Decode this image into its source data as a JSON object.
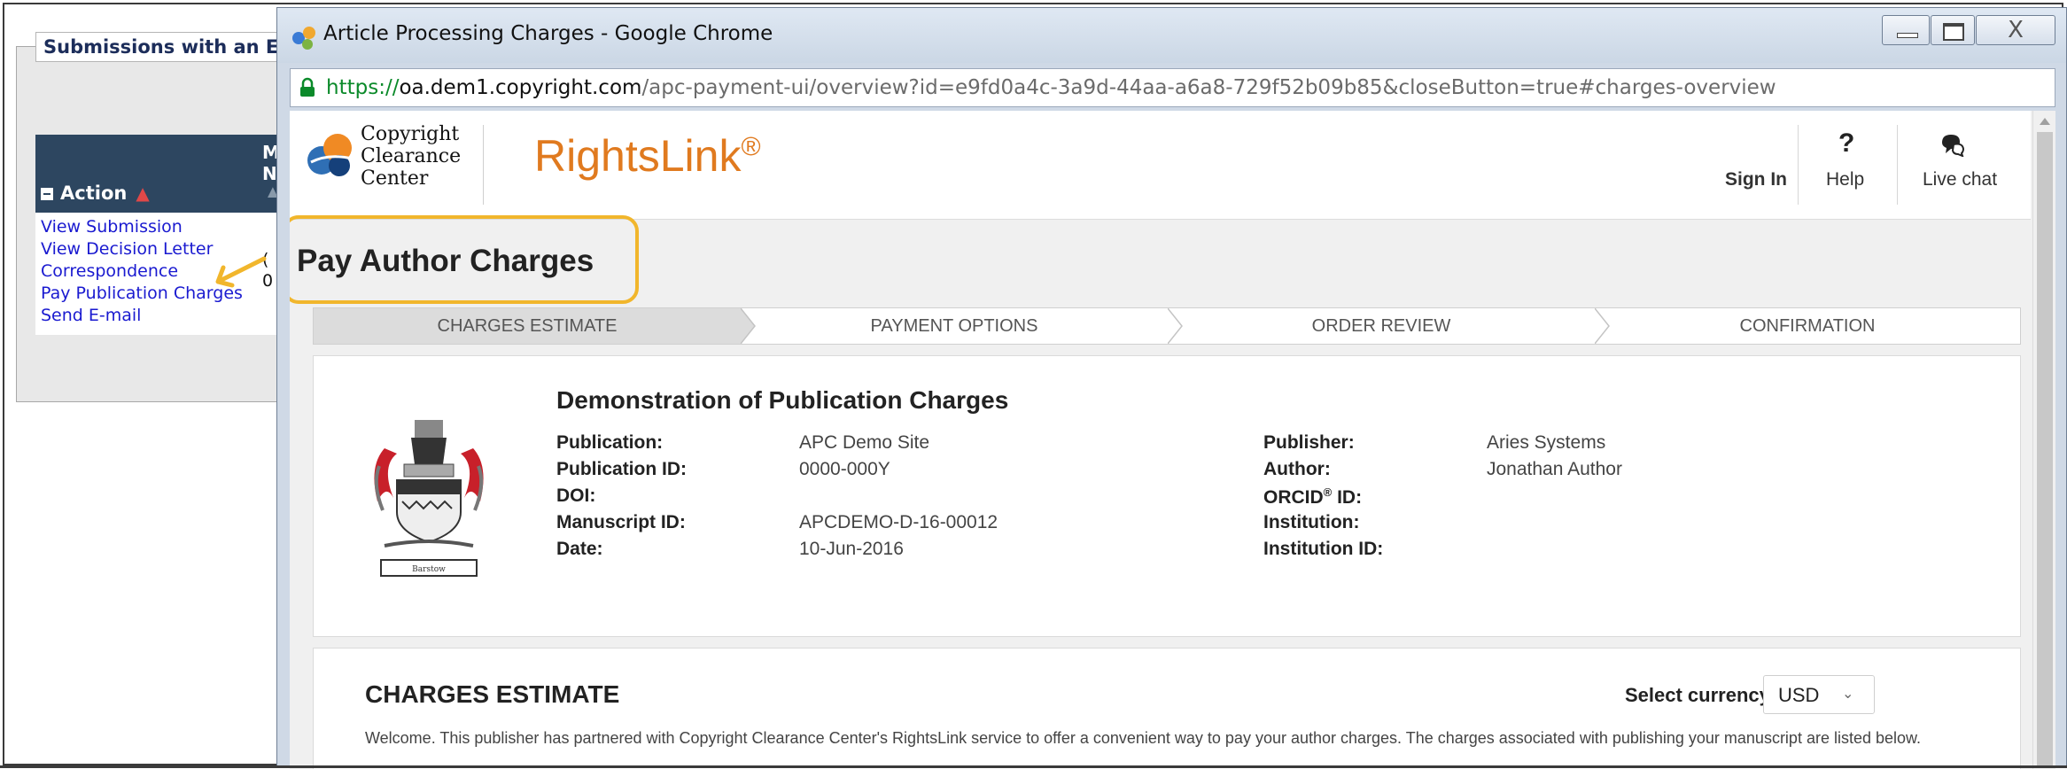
{
  "background_app": {
    "panel_title": "Submissions with an Ed",
    "action_header": "Action",
    "column_header_fragment": "M\nN",
    "links": [
      "View Submission",
      "View Decision Letter",
      "Correspondence",
      "Pay Publication Charges",
      "Send E-mail"
    ],
    "row_fragments": [
      "(",
      "0"
    ]
  },
  "window": {
    "title": "Article Processing Charges - Google Chrome",
    "url_scheme": "https://",
    "url_host": "oa.dem1.copyright.com",
    "url_path": "/apc-payment-ui/overview?id=e9fd0a4c-3a9d-44aa-a6a8-729f52b09b85&closeButton=true#charges-overview",
    "close_glyph": "X"
  },
  "header": {
    "logo_lines": [
      "Copyright",
      "Clearance",
      "Center"
    ],
    "brand": "RightsLink",
    "brand_mark": "®",
    "sign_in": "Sign In",
    "help_glyph": "?",
    "help": "Help",
    "live_chat": "Live chat"
  },
  "page_title": "Pay Author Charges",
  "steps": [
    "CHARGES ESTIMATE",
    "PAYMENT OPTIONS",
    "ORDER REVIEW",
    "CONFIRMATION"
  ],
  "publication_card": {
    "title": "Demonstration of Publication Charges",
    "crest_caption": "Barstow",
    "left_labels": [
      "Publication:",
      "Publication ID:",
      "DOI:",
      "Manuscript ID:",
      "Date:"
    ],
    "left_values": [
      "APC Demo Site",
      "0000-000Y",
      "",
      "APCDEMO-D-16-00012",
      "10-Jun-2016"
    ],
    "right_labels": [
      "Publisher:",
      "Author:",
      "ORCID",
      "Institution:",
      "Institution ID:"
    ],
    "orcid_mark": "®",
    "orcid_suffix": " ID:",
    "right_values": [
      "Aries Systems",
      "Jonathan Author",
      "",
      "",
      ""
    ]
  },
  "charges_estimate": {
    "title": "CHARGES ESTIMATE",
    "currency_label": "Select currency:",
    "currency_value": "USD",
    "welcome_text": "Welcome. This publisher has partnered with Copyright Clearance Center's RightsLink service to offer a convenient way to pay your author charges. The charges associated with publishing your manuscript are listed below."
  },
  "colors": {
    "brand_orange": "#e07a1f",
    "callout_yellow": "#f1b62c",
    "link_blue": "#1a1ad0",
    "table_header": "#2d4660"
  },
  "icons": [
    "chrome-app-icon",
    "lock-icon",
    "ccc-logo",
    "help-icon",
    "chat-icon",
    "crest-image",
    "arrow-icon"
  ]
}
